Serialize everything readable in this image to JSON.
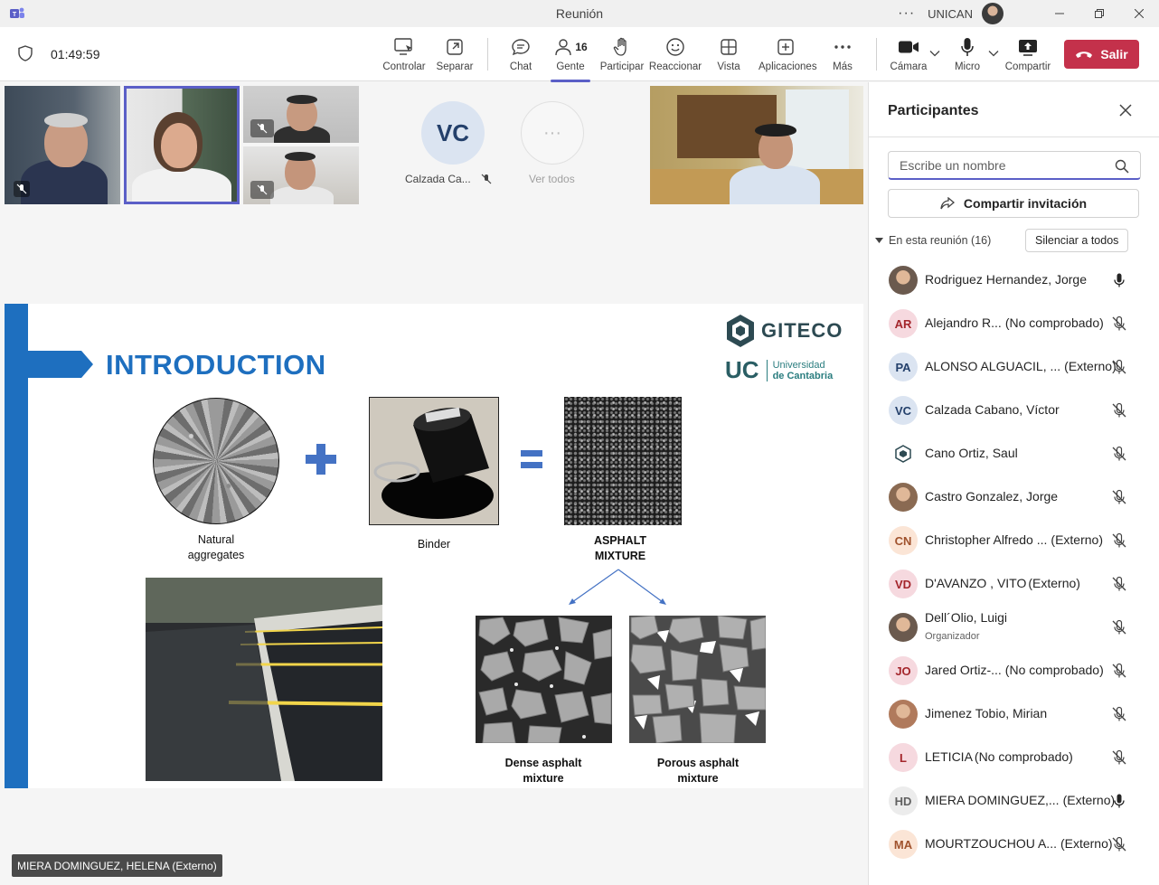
{
  "window": {
    "title": "Reunión",
    "org": "UNICAN",
    "more": "···"
  },
  "toolbar": {
    "timer": "01:49:59",
    "items": [
      {
        "label": "Controlar",
        "icon": "control-screen-icon"
      },
      {
        "label": "Separar",
        "icon": "pop-out-icon"
      },
      {
        "label": "Chat",
        "icon": "chat-icon"
      },
      {
        "label": "Gente",
        "icon": "people-icon",
        "badge": "16"
      },
      {
        "label": "Participar",
        "icon": "raise-hand-icon"
      },
      {
        "label": "Reaccionar",
        "icon": "smiley-icon"
      },
      {
        "label": "Vista",
        "icon": "grid-view-icon"
      },
      {
        "label": "Aplicaciones",
        "icon": "add-apps-icon"
      },
      {
        "label": "Más",
        "icon": "more-icon"
      },
      {
        "label": "Cámara",
        "icon": "camera-icon"
      },
      {
        "label": "Micro",
        "icon": "microphone-icon"
      },
      {
        "label": "Compartir",
        "icon": "share-screen-icon"
      }
    ],
    "leave_label": "Salir",
    "accent": "#5b5fc7",
    "leave_color": "#c4314b"
  },
  "stage": {
    "vc_initials": "VC",
    "vc_label": "Calzada Ca...",
    "see_all_label": "Ver todos",
    "speaker_name": "MIERA DOMINGUEZ, HELENA (Externo)"
  },
  "slide": {
    "title": "INTRODUCTION",
    "logo_text": "GITECO",
    "uc_text": "UC",
    "uc_line1": "Universidad",
    "uc_line2": "de Cantabria",
    "cap_aggregates_1": "Natural",
    "cap_aggregates_2": "aggregates",
    "cap_binder": "Binder",
    "cap_mixture_1": "ASPHALT",
    "cap_mixture_2": "MIXTURE",
    "cap_dense_1": "Dense asphalt",
    "cap_dense_2": "mixture",
    "cap_porous_1": "Porous asphalt",
    "cap_porous_2": "mixture",
    "accent": "#1e6fbf"
  },
  "panel": {
    "title": "Participantes",
    "search_placeholder": "Escribe un nombre",
    "invite_label": "Compartir invitación",
    "section_label": "En esta reunión (16)",
    "mute_all_label": "Silenciar a todos",
    "participants": [
      {
        "name": "Rodriguez Hernandez, Jorge",
        "suffix": "",
        "initials": "",
        "avatar": "photo",
        "mic": "on",
        "role": ""
      },
      {
        "name": "Alejandro R...",
        "suffix": "(No comprobado)",
        "initials": "AR",
        "avatar_bg": "#f6d9df",
        "avatar_fg": "#a4262c",
        "mic": "off",
        "role": ""
      },
      {
        "name": "ALONSO ALGUACIL, ...",
        "suffix": "(Externo)",
        "initials": "PA",
        "avatar_bg": "#dbe4f1",
        "avatar_fg": "#24406b",
        "mic": "off",
        "role": ""
      },
      {
        "name": "Calzada Cabano, Víctor",
        "suffix": "",
        "initials": "VC",
        "avatar_bg": "#dbe4f1",
        "avatar_fg": "#24406b",
        "mic": "off",
        "role": ""
      },
      {
        "name": "Cano Ortiz, Saul",
        "suffix": "",
        "initials": "",
        "avatar": "logo",
        "mic": "off",
        "role": ""
      },
      {
        "name": "Castro Gonzalez, Jorge",
        "suffix": "",
        "initials": "",
        "avatar": "photo",
        "mic": "off",
        "role": ""
      },
      {
        "name": "Christopher Alfredo ...",
        "suffix": "(Externo)",
        "initials": "CN",
        "avatar_bg": "#fbe5d6",
        "avatar_fg": "#a0522d",
        "mic": "off",
        "role": ""
      },
      {
        "name": "D'AVANZO , VITO",
        "suffix": "(Externo)",
        "initials": "VD",
        "avatar_bg": "#f6d9df",
        "avatar_fg": "#a4262c",
        "mic": "off",
        "role": ""
      },
      {
        "name": "Dell´Olio, Luigi",
        "suffix": "",
        "initials": "",
        "avatar": "photo",
        "mic": "off",
        "role": "Organizador"
      },
      {
        "name": "Jared Ortiz-...",
        "suffix": "(No comprobado)",
        "initials": "JO",
        "avatar_bg": "#f6d9df",
        "avatar_fg": "#a4262c",
        "mic": "off",
        "role": ""
      },
      {
        "name": "Jimenez Tobio, Mirian",
        "suffix": "",
        "initials": "",
        "avatar": "photo",
        "mic": "off",
        "role": ""
      },
      {
        "name": "LETICIA",
        "suffix": "(No comprobado)",
        "initials": "L",
        "avatar_bg": "#f6d9df",
        "avatar_fg": "#a4262c",
        "mic": "off",
        "role": ""
      },
      {
        "name": "MIERA DOMINGUEZ,...",
        "suffix": "(Externo)",
        "initials": "HD",
        "avatar_bg": "#ececec",
        "avatar_fg": "#616161",
        "mic": "on",
        "role": ""
      },
      {
        "name": "MOURTZOUCHOU A...",
        "suffix": "(Externo)",
        "initials": "MA",
        "avatar_bg": "#fbe5d6",
        "avatar_fg": "#a0522d",
        "mic": "off",
        "role": ""
      }
    ]
  }
}
